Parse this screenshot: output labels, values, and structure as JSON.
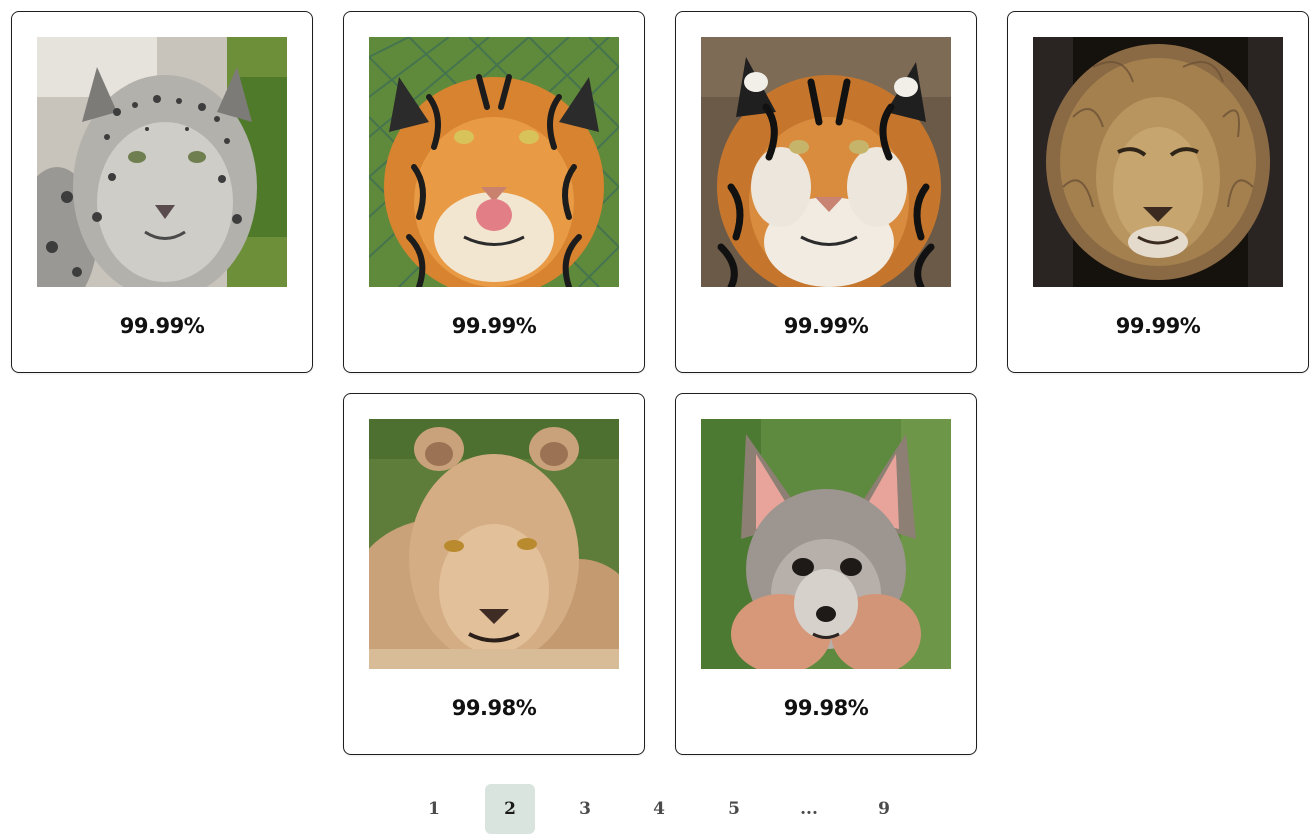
{
  "results": [
    {
      "score": "99.99%",
      "image": "snow-leopard-photo"
    },
    {
      "score": "99.99%",
      "image": "tiger-tongue-photo"
    },
    {
      "score": "99.99%",
      "image": "tiger-photo"
    },
    {
      "score": "99.99%",
      "image": "lion-photo"
    },
    {
      "score": "99.98%",
      "image": "lioness-photo"
    },
    {
      "score": "99.98%",
      "image": "gray-fox-photo"
    }
  ],
  "pagination": {
    "pages": [
      "1",
      "2",
      "3",
      "4",
      "5",
      "...",
      "9"
    ],
    "current": "2",
    "active_color": "#d9e4df"
  }
}
